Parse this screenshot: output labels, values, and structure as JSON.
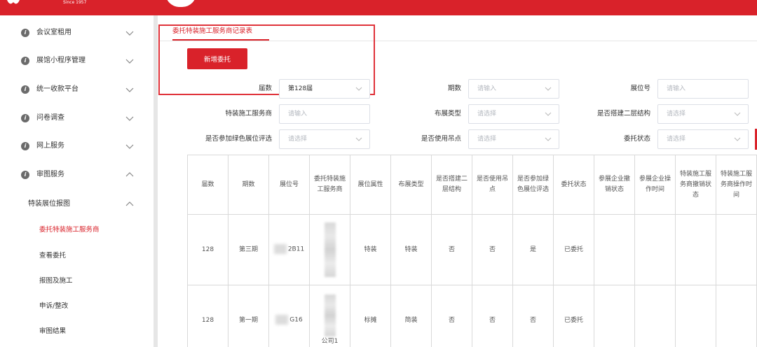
{
  "brand": {
    "since": "Since 1957",
    "color": "#d9222a"
  },
  "sidebar": {
    "items": [
      {
        "label": "会议室租用",
        "expanded": false
      },
      {
        "label": "展馆小程序管理",
        "expanded": false
      },
      {
        "label": "统一收款平台",
        "expanded": false
      },
      {
        "label": "问卷调查",
        "expanded": false
      },
      {
        "label": "网上服务",
        "expanded": false
      },
      {
        "label": "审图服务",
        "expanded": true
      }
    ],
    "submenu": {
      "label": "特装展位报图",
      "expanded": true
    },
    "leaves": [
      {
        "label": "委托特装施工服务商",
        "active": true
      },
      {
        "label": "查看委托",
        "active": false
      },
      {
        "label": "报图及施工",
        "active": false
      },
      {
        "label": "申诉/整改",
        "active": false
      },
      {
        "label": "审图结果",
        "active": false
      }
    ]
  },
  "main": {
    "tab": "委托特装施工服务商记录表",
    "add_button": "新增委托",
    "filters": {
      "session": {
        "label": "届数",
        "value": "第128届"
      },
      "period": {
        "label": "期数",
        "placeholder": "请输入"
      },
      "booth_no": {
        "label": "展位号",
        "placeholder": "请输入"
      },
      "contractor": {
        "label": "特装施工服务商",
        "placeholder": "请输入"
      },
      "layout_type": {
        "label": "布展类型",
        "placeholder": "请选择"
      },
      "second_floor": {
        "label": "是否搭建二层结构",
        "placeholder": "请选择"
      },
      "green_eval": {
        "label": "是否参加绿色展位评选",
        "placeholder": "请选择"
      },
      "hanging": {
        "label": "是否使用吊点",
        "placeholder": "请选择"
      },
      "entrust_status": {
        "label": "委托状态",
        "placeholder": "请选择"
      }
    },
    "table": {
      "headers": [
        "届数",
        "期数",
        "展位号",
        "委托特装施工服务商",
        "展位属性",
        "布展类型",
        "是否搭建二层结构",
        "是否使用吊点",
        "是否参加绿色展位评选",
        "委托状态",
        "参展企业撤销状态",
        "参展企业操作时间",
        "特装施工服务商撤销状态",
        "特装施工服务商操作时间"
      ],
      "rows": [
        {
          "session": "128",
          "period": "第三期",
          "booth": "2B11",
          "contractor": "",
          "attr": "特装",
          "layout": "特装",
          "second_floor": "否",
          "hanging": "否",
          "green": "是",
          "status": "已委托",
          "ex_cancel": "",
          "ex_time": "",
          "sc_cancel": "",
          "sc_time": ""
        },
        {
          "session": "128",
          "period": "第一期",
          "booth": "G16",
          "contractor": "公司1",
          "attr": "标摊",
          "layout": "简装",
          "second_floor": "否",
          "hanging": "否",
          "green": "否",
          "status": "已委托",
          "ex_cancel": "",
          "ex_time": "",
          "sc_cancel": "",
          "sc_time": ""
        }
      ]
    }
  }
}
